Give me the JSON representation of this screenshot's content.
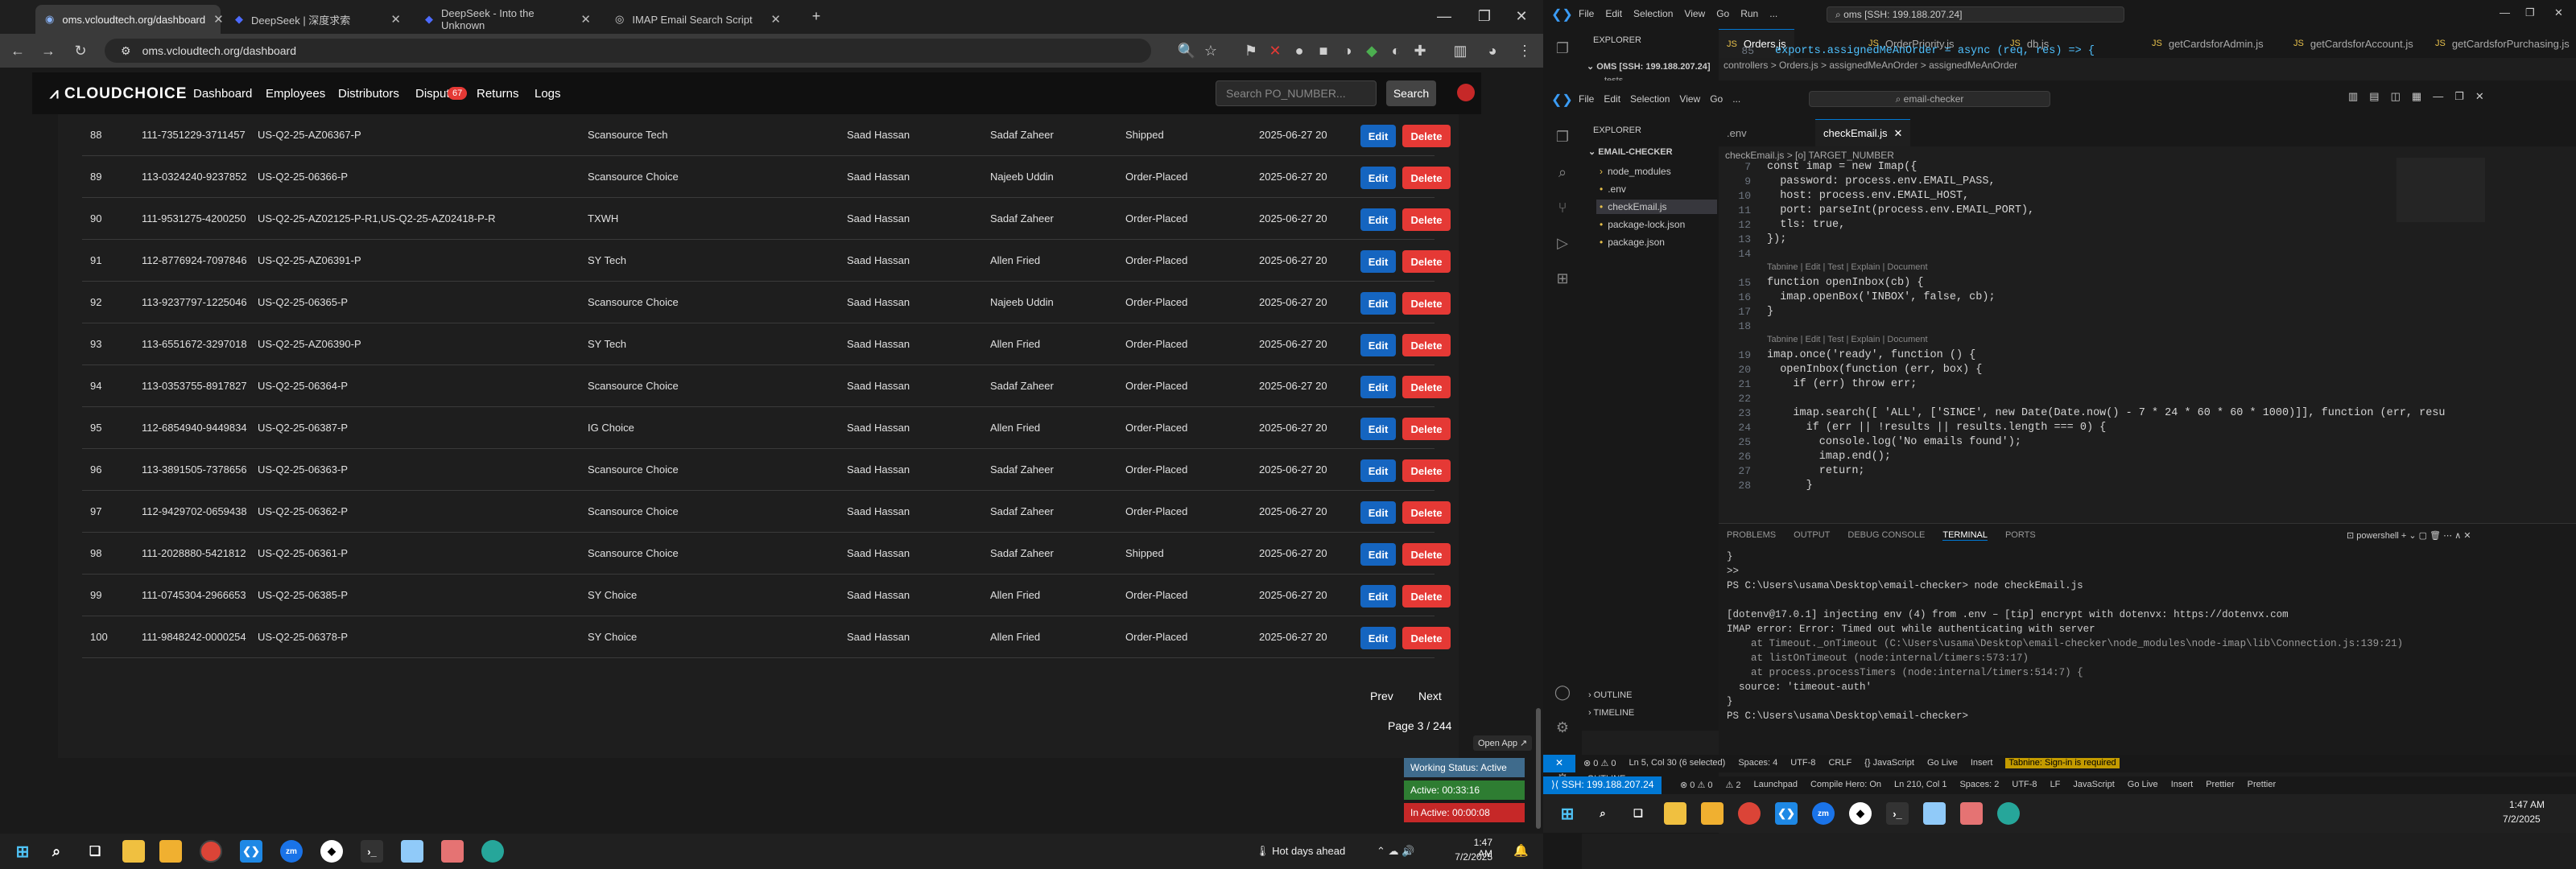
{
  "browser": {
    "tabs": [
      {
        "title": "oms.vcloudtech.org/dashboard",
        "active": true
      },
      {
        "title": "DeepSeek | 深度求索",
        "active": false
      },
      {
        "title": "DeepSeek - Into the Unknown",
        "active": false
      },
      {
        "title": "IMAP Email Search Script",
        "active": false
      }
    ],
    "url": "oms.vcloudtech.org/dashboard"
  },
  "site": {
    "logo": "CLOUDCHOICE",
    "nav": [
      "Dashboard",
      "Employees",
      "Distributors",
      "Disputes",
      "Returns",
      "Logs"
    ],
    "dispute_count": "67",
    "search_placeholder": "Search PO_NUMBER...",
    "search_label": "Search",
    "edit_label": "Edit",
    "delete_label": "Delete",
    "prev_label": "Prev",
    "next_label": "Next",
    "page_info": "Page 3 / 244",
    "open_app": "Open App ↗"
  },
  "orders": [
    {
      "no": "88",
      "po": "111-7351229-3711457",
      "ref": "US-Q2-25-AZ06367-P",
      "dist": "Scansource Tech",
      "emp": "Saad Hassan",
      "handler": "Sadaf Zaheer",
      "status": "Shipped",
      "date": "2025-06-27 20"
    },
    {
      "no": "89",
      "po": "113-0324240-9237852",
      "ref": "US-Q2-25-06366-P",
      "dist": "Scansource Choice",
      "emp": "Saad Hassan",
      "handler": "Najeeb Uddin",
      "status": "Order-Placed",
      "date": "2025-06-27 20"
    },
    {
      "no": "90",
      "po": "111-9531275-4200250",
      "ref": "US-Q2-25-AZ02125-P-R1,US-Q2-25-AZ02418-P-R",
      "dist": "TXWH",
      "emp": "Saad Hassan",
      "handler": "Sadaf Zaheer",
      "status": "Order-Placed",
      "date": "2025-06-27 20"
    },
    {
      "no": "91",
      "po": "112-8776924-7097846",
      "ref": "US-Q2-25-AZ06391-P",
      "dist": "SY Tech",
      "emp": "Saad Hassan",
      "handler": "Allen Fried",
      "status": "Order-Placed",
      "date": "2025-06-27 20"
    },
    {
      "no": "92",
      "po": "113-9237797-1225046",
      "ref": "US-Q2-25-06365-P",
      "dist": "Scansource Choice",
      "emp": "Saad Hassan",
      "handler": "Najeeb Uddin",
      "status": "Order-Placed",
      "date": "2025-06-27 20"
    },
    {
      "no": "93",
      "po": "113-6551672-3297018",
      "ref": "US-Q2-25-AZ06390-P",
      "dist": "SY Tech",
      "emp": "Saad Hassan",
      "handler": "Allen Fried",
      "status": "Order-Placed",
      "date": "2025-06-27 20"
    },
    {
      "no": "94",
      "po": "113-0353755-8917827",
      "ref": "US-Q2-25-06364-P",
      "dist": "Scansource Choice",
      "emp": "Saad Hassan",
      "handler": "Sadaf Zaheer",
      "status": "Order-Placed",
      "date": "2025-06-27 20"
    },
    {
      "no": "95",
      "po": "112-6854940-9449834",
      "ref": "US-Q2-25-06387-P",
      "dist": "IG Choice",
      "emp": "Saad Hassan",
      "handler": "Allen Fried",
      "status": "Order-Placed",
      "date": "2025-06-27 20"
    },
    {
      "no": "96",
      "po": "113-3891505-7378656",
      "ref": "US-Q2-25-06363-P",
      "dist": "Scansource Choice",
      "emp": "Saad Hassan",
      "handler": "Sadaf Zaheer",
      "status": "Order-Placed",
      "date": "2025-06-27 20"
    },
    {
      "no": "97",
      "po": "112-9429702-0659438",
      "ref": "US-Q2-25-06362-P",
      "dist": "Scansource Choice",
      "emp": "Saad Hassan",
      "handler": "Sadaf Zaheer",
      "status": "Order-Placed",
      "date": "2025-06-27 20"
    },
    {
      "no": "98",
      "po": "111-2028880-5421812",
      "ref": "US-Q2-25-06361-P",
      "dist": "Scansource Choice",
      "emp": "Saad Hassan",
      "handler": "Sadaf Zaheer",
      "status": "Shipped",
      "date": "2025-06-27 20"
    },
    {
      "no": "99",
      "po": "111-0745304-2966653",
      "ref": "US-Q2-25-06385-P",
      "dist": "SY Choice",
      "emp": "Saad Hassan",
      "handler": "Allen Fried",
      "status": "Order-Placed",
      "date": "2025-06-27 20"
    },
    {
      "no": "100",
      "po": "111-9848242-0000254",
      "ref": "US-Q2-25-06378-P",
      "dist": "SY Choice",
      "emp": "Saad Hassan",
      "handler": "Allen Fried",
      "status": "Order-Placed",
      "date": "2025-06-27 20"
    }
  ],
  "work_status": {
    "working": "Working Status: Active",
    "active": "Active: 00:33:16",
    "inactive": "In Active: 00:00:08"
  },
  "taskbar_left": {
    "weather": "Hot days ahead",
    "time": "1:47 AM",
    "date": "7/2/2025"
  },
  "vscode": {
    "menu": [
      "File",
      "Edit",
      "Selection",
      "View",
      "Go",
      "Run",
      "..."
    ],
    "search": "oms [SSH: 199.188.207.24]",
    "tabs": [
      "Orders.js",
      "OrderPriority.js",
      "db.js",
      "getCardsforAdmin.js",
      "getCardsforAccount.js",
      "getCardsforPurchasing.js"
    ],
    "breadcrumb": "controllers > Orders.js > assignedMeAnOrder > assignedMeAnOrder",
    "explorer_title": "EXPLORER",
    "root": "OMS [SSH: 199.188.207.24]",
    "outer_line_no": "85",
    "outer_line": "exports.assignedMeAnOrder = async (req, res) => {",
    "outer_folder": "tests",
    "status_remote": "SSH: 199.188.207.24",
    "status_items": [
      "⊗ 0 ⚠ 0",
      "⚠ 2",
      "Launchpad",
      "Compile Hero: On",
      "Ln 210, Col 1",
      "Spaces: 2",
      "UTF-8",
      "LF",
      "JavaScript",
      "Go Live",
      "Insert",
      "Prettier",
      "Prettier"
    ]
  },
  "inner": {
    "menu": [
      "File",
      "Edit",
      "Selection",
      "View",
      "Go",
      "..."
    ],
    "search": "email-checker",
    "explorer_title": "EXPLORER",
    "root": "EMAIL-CHECKER",
    "files": [
      "node_modules",
      ".env",
      "checkEmail.js",
      "package-lock.json",
      "package.json"
    ],
    "tabs": [
      ".env",
      "checkEmail.js"
    ],
    "breadcrumb": "checkEmail.js > [o] TARGET_NUMBER",
    "code_lines": [
      {
        "n": "7",
        "t": "const imap = new Imap({"
      },
      {
        "n": "9",
        "t": "  password: process.env.EMAIL_PASS,"
      },
      {
        "n": "10",
        "t": "  host: process.env.EMAIL_HOST,"
      },
      {
        "n": "11",
        "t": "  port: parseInt(process.env.EMAIL_PORT),"
      },
      {
        "n": "12",
        "t": "  tls: true,"
      },
      {
        "n": "13",
        "t": "});"
      },
      {
        "n": "14",
        "t": ""
      },
      {
        "n": "",
        "t": "Tabnine | Edit | Test | Explain | Document"
      },
      {
        "n": "15",
        "t": "function openInbox(cb) {"
      },
      {
        "n": "16",
        "t": "  imap.openBox('INBOX', false, cb);"
      },
      {
        "n": "17",
        "t": "}"
      },
      {
        "n": "18",
        "t": ""
      },
      {
        "n": "",
        "t": "Tabnine | Edit | Test | Explain | Document"
      },
      {
        "n": "19",
        "t": "imap.once('ready', function () {"
      },
      {
        "n": "20",
        "t": "  openInbox(function (err, box) {"
      },
      {
        "n": "21",
        "t": "    if (err) throw err;"
      },
      {
        "n": "22",
        "t": ""
      },
      {
        "n": "23",
        "t": "    imap.search([ 'ALL', ['SINCE', new Date(Date.now() - 7 * 24 * 60 * 60 * 1000)]], function (err, resu"
      },
      {
        "n": "24",
        "t": "      if (err || !results || results.length === 0) {"
      },
      {
        "n": "25",
        "t": "        console.log('No emails found');"
      },
      {
        "n": "26",
        "t": "        imap.end();"
      },
      {
        "n": "27",
        "t": "        return;"
      },
      {
        "n": "28",
        "t": "      }"
      }
    ],
    "panel_tabs": [
      "PROBLEMS",
      "OUTPUT",
      "DEBUG CONSOLE",
      "TERMINAL",
      "PORTS"
    ],
    "shell": "powershell",
    "terminal": [
      "}",
      ">>",
      "PS C:\\Users\\usama\\Desktop\\email-checker> node checkEmail.js",
      "",
      "[dotenv@17.0.1] injecting env (4) from .env – [tip] encrypt with dotenvx: https://dotenvx.com",
      "IMAP error: Error: Timed out while authenticating with server",
      "    at Timeout._onTimeout (C:\\Users\\usama\\Desktop\\email-checker\\node_modules\\node-imap\\lib\\Connection.js:139:21)",
      "    at listOnTimeout (node:internal/timers:573:17)",
      "    at process.processTimers (node:internal/timers:514:7) {",
      "  source: 'timeout-auth'",
      "}",
      "PS C:\\Users\\usama\\Desktop\\email-checker> "
    ],
    "outline": "OUTLINE",
    "timeline": "TIMELINE",
    "status_items": [
      "⊗ 0 ⚠ 0",
      "Ln 5, Col 30 (6 selected)",
      "Spaces: 4",
      "UTF-8",
      "CRLF",
      "{} JavaScript",
      "Go Live",
      "Insert",
      "Tabnine: Sign-in is required"
    ]
  },
  "taskbar_right": {
    "time": "1:47 AM",
    "date": "7/2/2025"
  }
}
